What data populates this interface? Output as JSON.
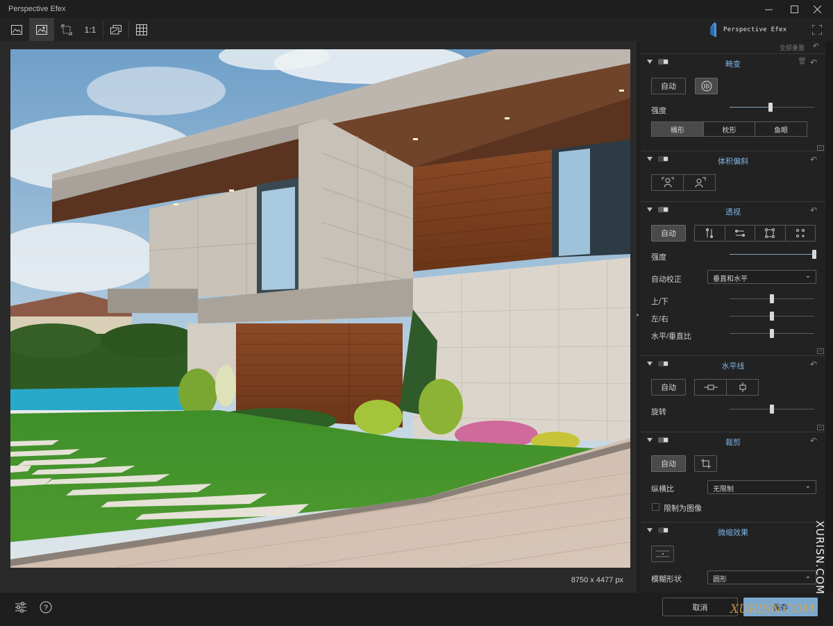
{
  "window": {
    "title": "Perspective Efex",
    "controls": [
      "minimize",
      "maximize",
      "close"
    ]
  },
  "toolbar": {
    "actual_size_label": "1:1",
    "brand_name": "Perspective Efex"
  },
  "canvas": {
    "image_dimensions": "8750 x 4477 px"
  },
  "panel": {
    "reset_all_label": "全部重置",
    "sections": {
      "distortion": {
        "title": "畸变",
        "auto_label": "自动",
        "strength_label": "强度",
        "strength_value": 0.48,
        "modes": [
          "桶形",
          "枕形",
          "鱼眼"
        ],
        "active_mode": "桶形"
      },
      "volume": {
        "title": "体积偏斜"
      },
      "perspective": {
        "title": "透视",
        "auto_label": "自动",
        "strength_label": "强度",
        "strength_value": 1.0,
        "auto_correct_label": "自动校正",
        "auto_correct_value": "垂直和水平",
        "vertical_label": "上/下",
        "vertical_value": 0.5,
        "horizontal_label": "左/右",
        "horizontal_value": 0.5,
        "ratio_label": "水平/垂直比",
        "ratio_value": 0.5
      },
      "horizon": {
        "title": "水平线",
        "auto_label": "自动",
        "rotate_label": "旋转",
        "rotate_value": 0.5
      },
      "crop": {
        "title": "裁剪",
        "auto_label": "自动",
        "aspect_label": "纵横比",
        "aspect_value": "无限制",
        "limit_label": "限制为图像"
      },
      "miniature": {
        "title": "微缩效果",
        "blur_shape_label": "模糊形状",
        "blur_shape_value": "圆形"
      }
    }
  },
  "bottom": {
    "cancel_label": "取消",
    "save_label": "保存"
  },
  "watermark": {
    "vertical": "XURISN.COM",
    "horizontal": "XURISN.COM"
  },
  "colors": {
    "accent": "#7fb4e6",
    "save_button": "#7da9cf",
    "panel_bg": "#222222",
    "app_bg": "#1b1b1b"
  }
}
